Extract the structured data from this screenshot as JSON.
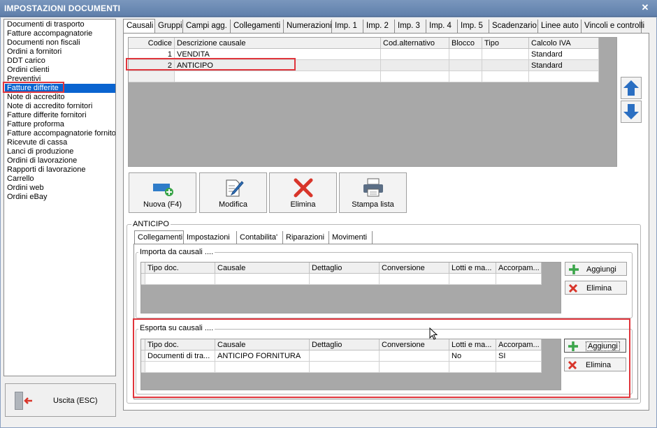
{
  "window": {
    "title": "IMPOSTAZIONI DOCUMENTI",
    "close_glyph": "✕"
  },
  "sidebar": {
    "items": [
      {
        "label": "Documenti di trasporto"
      },
      {
        "label": "Fatture accompagnatorie"
      },
      {
        "label": "Documenti non fiscali"
      },
      {
        "label": "Ordini a fornitori"
      },
      {
        "label": "DDT carico"
      },
      {
        "label": "Ordini clienti"
      },
      {
        "label": "Preventivi"
      },
      {
        "label": "Fatture differite",
        "selected": true
      },
      {
        "label": "Note di accredito"
      },
      {
        "label": "Note di accredito fornitori"
      },
      {
        "label": "Fatture differite fornitori"
      },
      {
        "label": "Fatture proforma"
      },
      {
        "label": "Fatture accompagnatorie fornito"
      },
      {
        "label": "Ricevute di cassa"
      },
      {
        "label": "Lanci di produzione"
      },
      {
        "label": "Ordini di lavorazione"
      },
      {
        "label": "Rapporti di lavorazione"
      },
      {
        "label": "Carrello"
      },
      {
        "label": "Ordini web"
      },
      {
        "label": "Ordini eBay"
      }
    ]
  },
  "exit_button": {
    "label": "Uscita (ESC)"
  },
  "tabs": [
    "Causali",
    "Gruppi",
    "Campi agg.",
    "Collegamenti",
    "Numerazioni",
    "Imp. 1",
    "Imp. 2",
    "Imp. 3",
    "Imp. 4",
    "Imp. 5",
    "Scadenzario",
    "Linee auto",
    "Vincoli e controlli"
  ],
  "causali_table": {
    "headers": [
      "Codice",
      "Descrizione causale",
      "Cod.alternativo",
      "Blocco",
      "Tipo",
      "Calcolo IVA"
    ],
    "rows": [
      [
        "1",
        "VENDITA",
        "",
        "",
        "",
        "Standard"
      ],
      [
        "2",
        "ANTICIPO",
        "",
        "",
        "",
        "Standard"
      ]
    ]
  },
  "actions": {
    "new": "Nuova (F4)",
    "edit": "Modifica",
    "delete": "Elimina",
    "print": "Stampa lista"
  },
  "detail": {
    "title": "ANTICIPO",
    "subtabs": [
      "Collegamenti",
      "Impostazioni",
      "Contabilita'",
      "Riparazioni",
      "Movimenti"
    ],
    "import_group": {
      "title": "Importa da causali ....",
      "headers": [
        "Tipo doc.",
        "Causale",
        "Dettaglio",
        "Conversione",
        "Lotti e ma...",
        "Accorpam..."
      ],
      "rows": [],
      "add": "Aggiungi",
      "remove": "Elimina"
    },
    "export_group": {
      "title": "Esporta su causali ....",
      "headers": [
        "Tipo doc.",
        "Causale",
        "Dettaglio",
        "Conversione",
        "Lotti e ma...",
        "Accorpam..."
      ],
      "rows": [
        [
          "Documenti di tra...",
          "ANTICIPO FORNITURA",
          "",
          "",
          "No",
          "SI"
        ]
      ],
      "add": "Aggiungi",
      "remove": "Elimina"
    }
  },
  "colors": {
    "title_bar": "#5f7fab",
    "selection": "#0a64d0",
    "highlight": "#e0353c",
    "arrow_blue": "#2b6fc2"
  }
}
